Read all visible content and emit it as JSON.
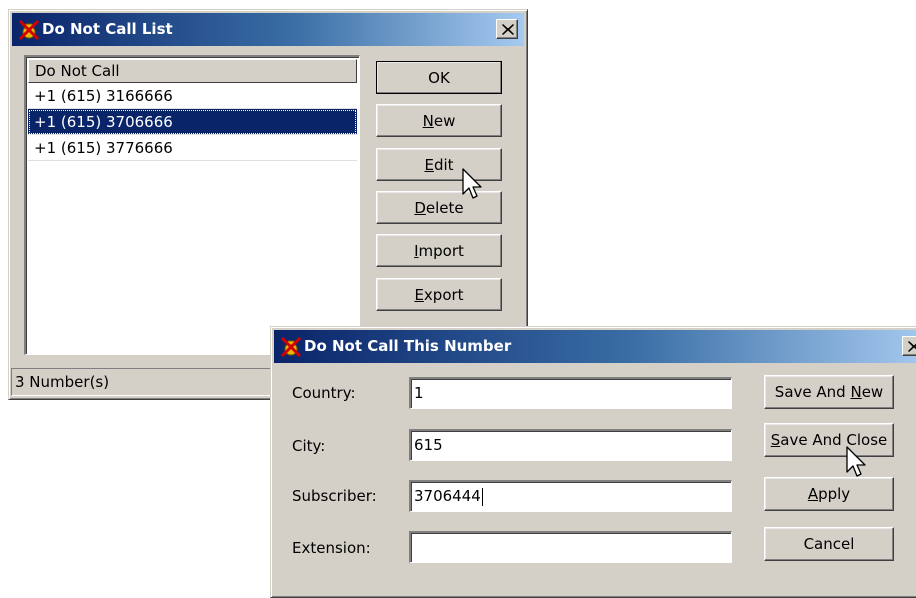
{
  "list_window": {
    "title": "Do Not Call List",
    "icon": "no-phone-icon",
    "close_icon": "close-icon",
    "column_header": "Do Not Call",
    "rows": [
      "+1 (615) 3166666",
      "+1 (615) 3706666",
      "+1 (615) 3776666"
    ],
    "selected_row": "+1 (615) 3706666",
    "buttons": {
      "ok": "OK",
      "new": {
        "mnemonic": "N",
        "rest": "ew"
      },
      "edit": {
        "mnemonic": "E",
        "rest": "dit"
      },
      "delete": {
        "mnemonic": "D",
        "rest": "elete"
      },
      "import": {
        "mnemonic": "I",
        "rest": "mport"
      },
      "export": {
        "mnemonic": "E",
        "rest": "xport"
      }
    },
    "status": "3 Number(s)"
  },
  "number_window": {
    "title": "Do Not Call This Number",
    "icon": "no-phone-icon",
    "labels": {
      "country": "Country:",
      "city": "City:",
      "subscriber": "Subscriber:",
      "extension": "Extension:"
    },
    "values": {
      "country": "1",
      "city": "615",
      "subscriber": "3706444",
      "extension": ""
    },
    "buttons": {
      "save_and_new": {
        "pre": "Save And ",
        "mnemonic": "N",
        "rest": "ew"
      },
      "save_and_close": {
        "pre": "",
        "mnemonic": "S",
        "rest": "ave And Close"
      },
      "apply": {
        "pre": "",
        "mnemonic": "A",
        "rest": "pply"
      },
      "cancel": "Cancel"
    }
  },
  "colors": {
    "face": "#d4d0c8",
    "title_start": "#0a246a",
    "title_end": "#a6caf0",
    "selection": "#0a246a"
  }
}
